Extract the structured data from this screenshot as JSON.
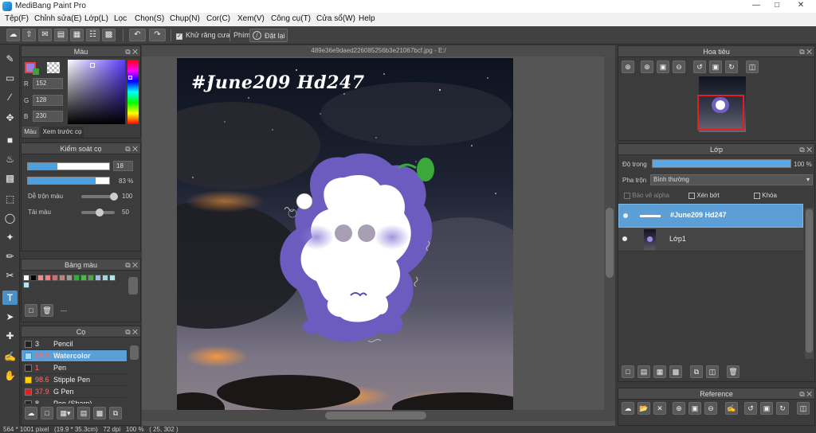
{
  "app": {
    "title": "MediBang Paint Pro"
  },
  "menu": [
    "Tệp(F)",
    "Chỉnh sửa(E)",
    "Lớp(L)",
    "Lọc",
    "Chọn(S)",
    "Chụp(N)",
    "Cor(C)",
    "Xem(V)",
    "Công cụ(T)",
    "Cửa sổ(W)",
    "Help"
  ],
  "toolbar": {
    "antialias_label": "Khử răng cưa",
    "key_label": "Phím",
    "reset_label": "Đặt lại"
  },
  "color_panel": {
    "title": "Màu",
    "r_label": "R",
    "g_label": "G",
    "b_label": "B",
    "r": "152",
    "g": "128",
    "b": "230",
    "tab_color": "Màu",
    "tab_preview": "Xem trước cọ",
    "current_color": "#9880e6"
  },
  "brush_control": {
    "title": "Kiểm soát cọ",
    "size": "18",
    "opacity": "83 %",
    "blend_label": "Dễ trộn màu",
    "blend_value": "100",
    "load_label": "Tải màu",
    "load_value": "50",
    "size_fill": 0.36,
    "opacity_fill": 0.83,
    "blend_fill": 1.0,
    "load_fill": 0.5
  },
  "palette": {
    "title": "Bảng màu",
    "dash": "---",
    "colors": [
      "#ffffff",
      "#000000",
      "#e89090",
      "#f08080",
      "#d07070",
      "#c08080",
      "#9a9a9a",
      "#30b030",
      "#40c040",
      "#50a050",
      "#a0c0e0",
      "#a0d8e0",
      "#b0e8f0"
    ]
  },
  "brush_panel": {
    "title": "Cọ",
    "items": [
      {
        "size": "3",
        "name": "Pencil",
        "color": "#222222",
        "selected": false
      },
      {
        "size": "18.8",
        "name": "Watercolor",
        "color": "#9be0ff",
        "selected": true
      },
      {
        "size": "1",
        "name": "Pen",
        "color": "#222222",
        "selected": false
      },
      {
        "size": "98.6",
        "name": "Stipple Pen",
        "color": "#ffd000",
        "selected": false
      },
      {
        "size": "37.9",
        "name": "G Pen",
        "color": "#e02020",
        "selected": false
      },
      {
        "size": "8",
        "name": "Pen (Sharp)",
        "color": "#222222",
        "selected": false
      }
    ]
  },
  "document": {
    "tab_title": "489e36e9daed226085256b3e21067bcf.jpg - E:/"
  },
  "artwork": {
    "text": "#June209 Hd247"
  },
  "navigator": {
    "title": "Hoa tiêu"
  },
  "layer_panel": {
    "title": "Lớp",
    "opacity_label": "Độ trong",
    "opacity_value": "100 %",
    "blend_label": "Pha trộn",
    "blend_value": "Bình thường",
    "protect_alpha": "Bảo vệ alpha",
    "clip": "Xén bớt",
    "lock": "Khóa",
    "layers": [
      {
        "name": "#June209 Hd247",
        "selected": true
      },
      {
        "name": "Lớp1",
        "selected": false
      }
    ]
  },
  "reference": {
    "title": "Reference"
  },
  "status": {
    "text": "564 * 1001 pixel   (19.9 * 35.3cm)   72 dpi   100 %   ( 25, 302 )"
  }
}
